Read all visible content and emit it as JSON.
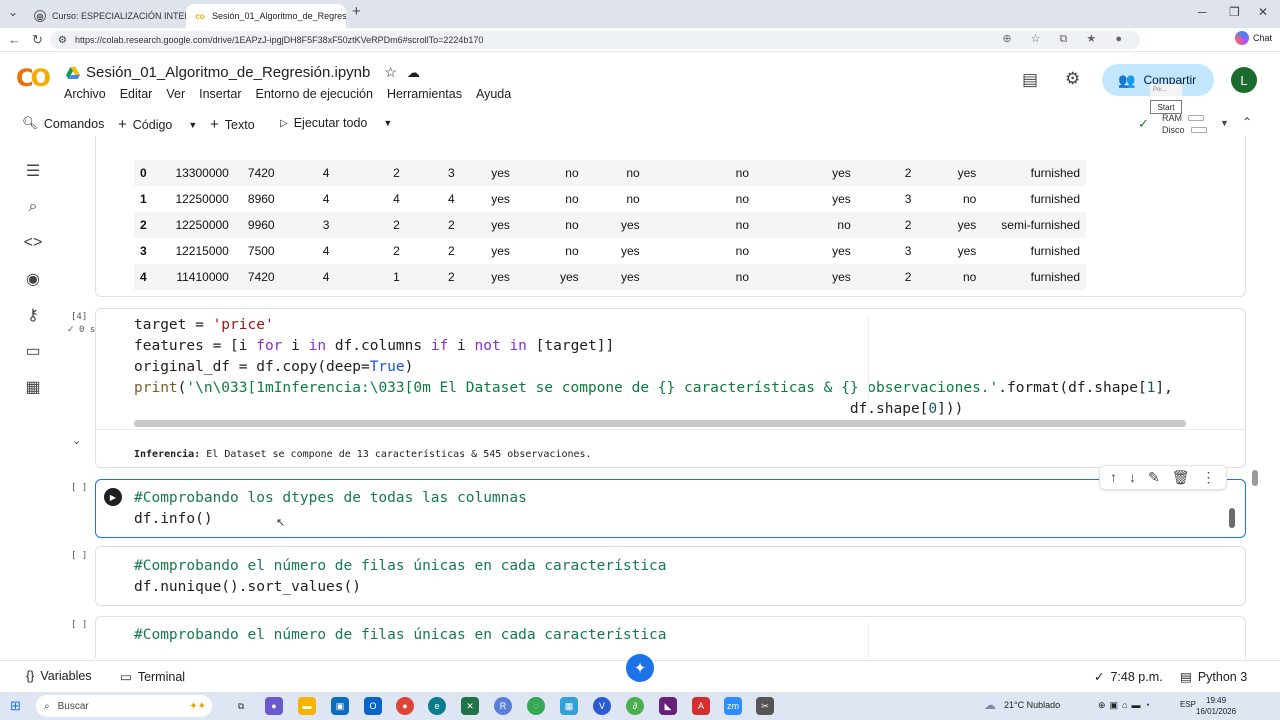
{
  "browser": {
    "tabs": [
      {
        "title": "Curso: ESPECIALIZACIÓN INTERN",
        "active": false
      },
      {
        "title": "Sesión_01_Algoritmo_de_Regresió",
        "active": true
      }
    ],
    "new_tab": "+",
    "url": "https://colab.research.google.com/drive/1EAPzJ-ipgjDH8F5F38xF50ztKVeRPDm6#scrollTo=2224b170",
    "chat_label": "Chat"
  },
  "colab": {
    "logo": "CO",
    "notebook_title": "Sesión_01_Algoritmo_de_Regresión.ipynb",
    "menu": [
      "Archivo",
      "Editar",
      "Ver",
      "Insertar",
      "Entorno de ejecución",
      "Herramientas",
      "Ayuda"
    ],
    "share_label": "Compartir",
    "avatar_letter": "L",
    "tooltip_start": "Start",
    "tooltip_poi": "Poi...",
    "toolbar": {
      "commands": "Comandos",
      "code": "Código",
      "text": "Texto",
      "run_all": "Ejecutar todo"
    },
    "resources": {
      "ram": "RAM",
      "disk": "Disco"
    }
  },
  "dataframe": {
    "rows": [
      [
        "0",
        "13300000",
        "7420",
        "4",
        "2",
        "3",
        "yes",
        "no",
        "no",
        "no",
        "yes",
        "2",
        "yes",
        "furnished"
      ],
      [
        "1",
        "12250000",
        "8960",
        "4",
        "4",
        "4",
        "yes",
        "no",
        "no",
        "no",
        "yes",
        "3",
        "no",
        "furnished"
      ],
      [
        "2",
        "12250000",
        "9960",
        "3",
        "2",
        "2",
        "yes",
        "no",
        "yes",
        "no",
        "no",
        "2",
        "yes",
        "semi-furnished"
      ],
      [
        "3",
        "12215000",
        "7500",
        "4",
        "2",
        "2",
        "yes",
        "no",
        "yes",
        "no",
        "yes",
        "3",
        "yes",
        "furnished"
      ],
      [
        "4",
        "11410000",
        "7420",
        "4",
        "1",
        "2",
        "yes",
        "yes",
        "yes",
        "no",
        "yes",
        "2",
        "no",
        "furnished"
      ]
    ]
  },
  "cell4": {
    "exec_count": "[4]",
    "status": "0 s",
    "output_bold": "Inferencia:",
    "output_rest": " El Dataset se compone de 13 características & 545 observaciones."
  },
  "cell5": {
    "exec_count": "[ ]"
  },
  "cell6": {
    "exec_count": "[ ]"
  },
  "cell7": {
    "exec_count": "[ ]"
  },
  "statusbar": {
    "variables": "Variables",
    "terminal": "Terminal",
    "time": "7:48 p.m.",
    "runtime": "Python 3"
  },
  "taskbar": {
    "search": "Buscar",
    "weather": "21°C  Nublado",
    "lang": "ESP",
    "clock_time": "19:49",
    "clock_date": "16/01/2026"
  }
}
